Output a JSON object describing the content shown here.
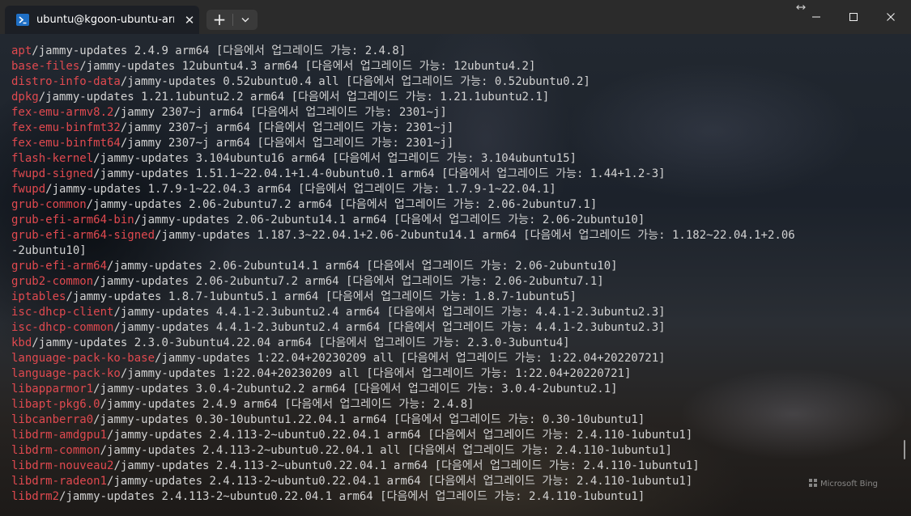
{
  "window": {
    "tab_title": "ubuntu@kgoon-ubuntu-arm",
    "tab_icon": "terminal-icon",
    "new_tab_label": "+",
    "close_tab_label": "✕"
  },
  "terminal": {
    "lines": [
      {
        "pkg": "apt",
        "rest": "/jammy-updates 2.4.9 arm64 [다음에서 업그레이드 가능: 2.4.8]"
      },
      {
        "pkg": "base-files",
        "rest": "/jammy-updates 12ubuntu4.3 arm64 [다음에서 업그레이드 가능: 12ubuntu4.2]"
      },
      {
        "pkg": "distro-info-data",
        "rest": "/jammy-updates 0.52ubuntu0.4 all [다음에서 업그레이드 가능: 0.52ubuntu0.2]"
      },
      {
        "pkg": "dpkg",
        "rest": "/jammy-updates 1.21.1ubuntu2.2 arm64 [다음에서 업그레이드 가능: 1.21.1ubuntu2.1]"
      },
      {
        "pkg": "fex-emu-armv8.2",
        "rest": "/jammy 2307~j arm64 [다음에서 업그레이드 가능: 2301~j]"
      },
      {
        "pkg": "fex-emu-binfmt32",
        "rest": "/jammy 2307~j arm64 [다음에서 업그레이드 가능: 2301~j]"
      },
      {
        "pkg": "fex-emu-binfmt64",
        "rest": "/jammy 2307~j arm64 [다음에서 업그레이드 가능: 2301~j]"
      },
      {
        "pkg": "flash-kernel",
        "rest": "/jammy-updates 3.104ubuntu16 arm64 [다음에서 업그레이드 가능: 3.104ubuntu15]"
      },
      {
        "pkg": "fwupd-signed",
        "rest": "/jammy-updates 1.51.1~22.04.1+1.4-0ubuntu0.1 arm64 [다음에서 업그레이드 가능: 1.44+1.2-3]"
      },
      {
        "pkg": "fwupd",
        "rest": "/jammy-updates 1.7.9-1~22.04.3 arm64 [다음에서 업그레이드 가능: 1.7.9-1~22.04.1]"
      },
      {
        "pkg": "grub-common",
        "rest": "/jammy-updates 2.06-2ubuntu7.2 arm64 [다음에서 업그레이드 가능: 2.06-2ubuntu7.1]"
      },
      {
        "pkg": "grub-efi-arm64-bin",
        "rest": "/jammy-updates 2.06-2ubuntu14.1 arm64 [다음에서 업그레이드 가능: 2.06-2ubuntu10]"
      },
      {
        "pkg": "grub-efi-arm64-signed",
        "rest": "/jammy-updates 1.187.3~22.04.1+2.06-2ubuntu14.1 arm64 [다음에서 업그레이드 가능: 1.182~22.04.1+2.06"
      },
      {
        "pkg": "",
        "rest": "-2ubuntu10]"
      },
      {
        "pkg": "grub-efi-arm64",
        "rest": "/jammy-updates 2.06-2ubuntu14.1 arm64 [다음에서 업그레이드 가능: 2.06-2ubuntu10]"
      },
      {
        "pkg": "grub2-common",
        "rest": "/jammy-updates 2.06-2ubuntu7.2 arm64 [다음에서 업그레이드 가능: 2.06-2ubuntu7.1]"
      },
      {
        "pkg": "iptables",
        "rest": "/jammy-updates 1.8.7-1ubuntu5.1 arm64 [다음에서 업그레이드 가능: 1.8.7-1ubuntu5]"
      },
      {
        "pkg": "isc-dhcp-client",
        "rest": "/jammy-updates 4.4.1-2.3ubuntu2.4 arm64 [다음에서 업그레이드 가능: 4.4.1-2.3ubuntu2.3]"
      },
      {
        "pkg": "isc-dhcp-common",
        "rest": "/jammy-updates 4.4.1-2.3ubuntu2.4 arm64 [다음에서 업그레이드 가능: 4.4.1-2.3ubuntu2.3]"
      },
      {
        "pkg": "kbd",
        "rest": "/jammy-updates 2.3.0-3ubuntu4.22.04 arm64 [다음에서 업그레이드 가능: 2.3.0-3ubuntu4]"
      },
      {
        "pkg": "language-pack-ko-base",
        "rest": "/jammy-updates 1:22.04+20230209 all [다음에서 업그레이드 가능: 1:22.04+20220721]"
      },
      {
        "pkg": "language-pack-ko",
        "rest": "/jammy-updates 1:22.04+20230209 all [다음에서 업그레이드 가능: 1:22.04+20220721]"
      },
      {
        "pkg": "libapparmor1",
        "rest": "/jammy-updates 3.0.4-2ubuntu2.2 arm64 [다음에서 업그레이드 가능: 3.0.4-2ubuntu2.1]"
      },
      {
        "pkg": "libapt-pkg6.0",
        "rest": "/jammy-updates 2.4.9 arm64 [다음에서 업그레이드 가능: 2.4.8]"
      },
      {
        "pkg": "libcanberra0",
        "rest": "/jammy-updates 0.30-10ubuntu1.22.04.1 arm64 [다음에서 업그레이드 가능: 0.30-10ubuntu1]"
      },
      {
        "pkg": "libdrm-amdgpu1",
        "rest": "/jammy-updates 2.4.113-2~ubuntu0.22.04.1 arm64 [다음에서 업그레이드 가능: 2.4.110-1ubuntu1]"
      },
      {
        "pkg": "libdrm-common",
        "rest": "/jammy-updates 2.4.113-2~ubuntu0.22.04.1 all [다음에서 업그레이드 가능: 2.4.110-1ubuntu1]"
      },
      {
        "pkg": "libdrm-nouveau2",
        "rest": "/jammy-updates 2.4.113-2~ubuntu0.22.04.1 arm64 [다음에서 업그레이드 가능: 2.4.110-1ubuntu1]"
      },
      {
        "pkg": "libdrm-radeon1",
        "rest": "/jammy-updates 2.4.113-2~ubuntu0.22.04.1 arm64 [다음에서 업그레이드 가능: 2.4.110-1ubuntu1]"
      },
      {
        "pkg": "libdrm2",
        "rest": "/jammy-updates 2.4.113-2~ubuntu0.22.04.1 arm64 [다음에서 업그레이드 가능: 2.4.110-1ubuntu1]"
      }
    ],
    "colors": {
      "package_name": "#e0494f",
      "text": "#d2d2d2",
      "tab_icon_bg": "#1f6fc5"
    }
  },
  "background_watermark": "Microsoft Bing"
}
